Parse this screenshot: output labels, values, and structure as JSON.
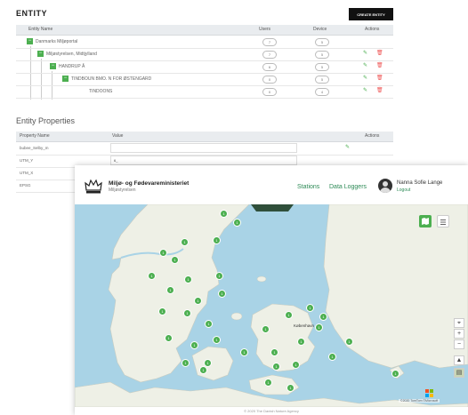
{
  "entity": {
    "title": "ENTITY",
    "create_label": "CREATE ENTITY",
    "columns": [
      "Entity Name",
      "Users",
      "Device",
      "Actions"
    ],
    "rows": [
      {
        "name": "Danmarks Miljøportal",
        "users": "7",
        "device": "5"
      },
      {
        "name": "Miljøstyrelsen, Midtjylland",
        "users": "7",
        "device": "5"
      },
      {
        "name": "HANDRUP Å",
        "users": "6",
        "device": "5"
      },
      {
        "name": "TINDBOUN BMO. N FOR ØSTENGARD",
        "users": "0",
        "device": "5"
      },
      {
        "name": "TINDOONS",
        "users": "0",
        "device": "4"
      }
    ]
  },
  "properties": {
    "title": "Entity Properties",
    "columns": [
      "Property Name",
      "Value",
      "Actions"
    ],
    "rows": [
      {
        "name": "bubee_Selby_m",
        "value": ""
      },
      {
        "name": "UTM_Y",
        "value": "6_"
      },
      {
        "name": "UTM_X",
        "value": ""
      },
      {
        "name": "EPSG",
        "value": ""
      }
    ]
  },
  "map_app": {
    "brand_title": "Miljø- og Fødevareministeriet",
    "brand_sub": "Miljøstyrelsen",
    "nav": [
      "Stations",
      "Data Loggers"
    ],
    "user_name": "Nanna Sofie Lange",
    "logout": "Logout",
    "footer": "© 2020 The Danish Nature Agency",
    "attribution": "©2020 TomTom ©Microsoft",
    "zoom_in": "+",
    "zoom_out": "−",
    "markers": [
      "1",
      "1",
      "1",
      "1",
      "1",
      "1",
      "1",
      "1",
      "1",
      "1",
      "1",
      "1",
      "1",
      "1",
      "1",
      "1",
      "1",
      "1",
      "1",
      "1",
      "1",
      "1",
      "1",
      "1",
      "1",
      "1",
      "1",
      "1",
      "1",
      "1",
      "1",
      "1",
      "1",
      "1",
      "1",
      "1"
    ],
    "city_label": "København"
  },
  "colors": {
    "accent": "#4caf50",
    "water": "#a9d3e6",
    "land": "#eef0e6",
    "delete": "#e55555"
  },
  "icons": [
    "crown-icon",
    "user-avatar-icon",
    "map-view-icon",
    "list-view-icon",
    "pencil-icon",
    "trash-icon",
    "location-pin-icon"
  ]
}
